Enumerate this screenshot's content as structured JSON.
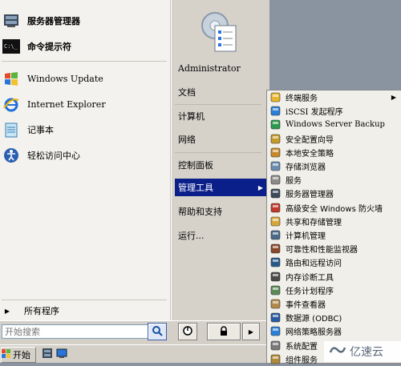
{
  "start_menu": {
    "pinned": [
      {
        "label": "服务器管理器",
        "icon": "server-manager-icon"
      },
      {
        "label": "命令提示符",
        "icon": "cmd-icon"
      }
    ],
    "recent": [
      {
        "label": "Windows Update",
        "icon": "windows-update-icon"
      },
      {
        "label": "Internet Explorer",
        "icon": "internet-explorer-icon"
      },
      {
        "label": "记事本",
        "icon": "notepad-icon"
      },
      {
        "label": "轻松访问中心",
        "icon": "ease-of-access-icon"
      }
    ],
    "all_programs": "所有程序",
    "right_items": [
      {
        "label": "Administrator"
      },
      {
        "label": "文档"
      },
      {
        "label": "计算机"
      },
      {
        "label": "网络"
      },
      {
        "label": "控制面板"
      },
      {
        "label": "管理工具",
        "selected": true,
        "arrow": "▶"
      },
      {
        "label": "帮助和支持"
      },
      {
        "label": "运行..."
      }
    ],
    "search_placeholder": "开始搜索",
    "power_arrow": "▶"
  },
  "submenu": {
    "items": [
      {
        "label": "终端服务",
        "icon": "folder-icon",
        "arrow": "▶"
      },
      {
        "label": "iSCSI 发起程序",
        "icon": "iscsi-icon"
      },
      {
        "label": "Windows Server Backup",
        "icon": "backup-icon"
      },
      {
        "label": "安全配置向导",
        "icon": "security-wizard-icon"
      },
      {
        "label": "本地安全策略",
        "icon": "local-security-policy-icon"
      },
      {
        "label": "存储浏览器",
        "icon": "storage-explorer-icon"
      },
      {
        "label": "服务",
        "icon": "services-icon"
      },
      {
        "label": "服务器管理器",
        "icon": "server-manager-icon"
      },
      {
        "label": "高级安全 Windows 防火墙",
        "icon": "firewall-icon"
      },
      {
        "label": "共享和存储管理",
        "icon": "share-storage-icon"
      },
      {
        "label": "计算机管理",
        "icon": "computer-management-icon"
      },
      {
        "label": "可靠性和性能监视器",
        "icon": "performance-monitor-icon"
      },
      {
        "label": "路由和远程访问",
        "icon": "routing-icon"
      },
      {
        "label": "内存诊断工具",
        "icon": "memory-diagnostic-icon"
      },
      {
        "label": "任务计划程序",
        "icon": "task-scheduler-icon"
      },
      {
        "label": "事件查看器",
        "icon": "event-viewer-icon"
      },
      {
        "label": "数据源 (ODBC)",
        "icon": "odbc-icon"
      },
      {
        "label": "网络策略服务器",
        "icon": "nps-icon"
      },
      {
        "label": "系统配置",
        "icon": "system-config-icon"
      },
      {
        "label": "组件服务",
        "icon": "component-services-icon"
      }
    ]
  },
  "taskbar": {
    "start_label": "开始"
  },
  "watermark": {
    "text": "亿速云"
  },
  "colors": {
    "selection": "#0b1f8a",
    "menu_bg": "#d4d0c8",
    "left_bg": "#f4f2ee",
    "submenu_bg": "#f0efe9"
  }
}
